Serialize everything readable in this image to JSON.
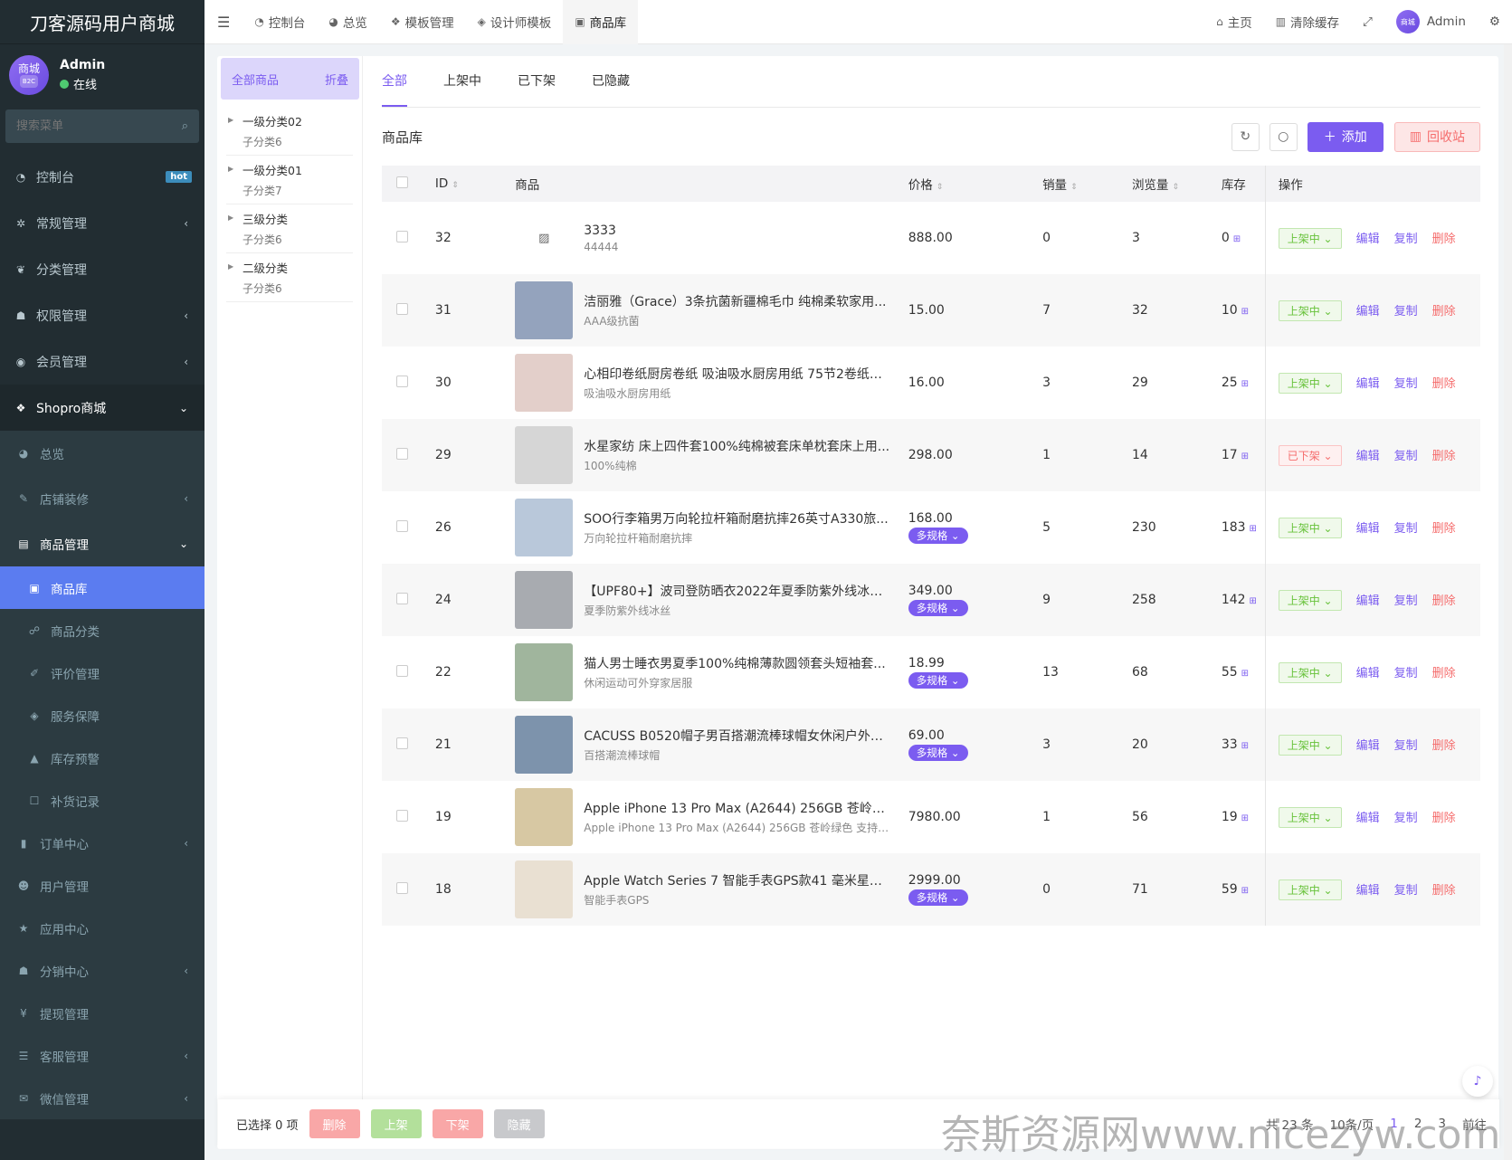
{
  "brand": "刀客源码用户商城",
  "user": {
    "name": "Admin",
    "status": "在线",
    "avatar_text": "商城",
    "avatar_badge": "B2C"
  },
  "search": {
    "placeholder": "搜索菜单"
  },
  "nav": [
    {
      "label": "控制台",
      "icon": "dashboard-icon",
      "badge": "hot"
    },
    {
      "label": "常规管理",
      "icon": "cogs-icon",
      "arrow": "‹"
    },
    {
      "label": "分类管理",
      "icon": "leaf-icon"
    },
    {
      "label": "权限管理",
      "icon": "group-icon",
      "arrow": "‹"
    },
    {
      "label": "会员管理",
      "icon": "user-circle-icon",
      "arrow": "‹"
    },
    {
      "label": "Shopro商城",
      "icon": "dropbox-icon",
      "arrow": "⌄"
    }
  ],
  "shopro": [
    {
      "label": "总览",
      "icon": "pie-icon"
    },
    {
      "label": "店铺装修",
      "icon": "brush-icon",
      "arrow": "‹"
    },
    {
      "label": "商品管理",
      "icon": "goods-icon",
      "arrow": "⌄"
    }
  ],
  "goods_menu": [
    {
      "label": "商品库",
      "icon": "bag-icon"
    },
    {
      "label": "商品分类",
      "icon": "sitemap-icon"
    },
    {
      "label": "评价管理",
      "icon": "edit-icon"
    },
    {
      "label": "服务保障",
      "icon": "tags-icon"
    },
    {
      "label": "库存预警",
      "icon": "warning-icon"
    },
    {
      "label": "补货记录",
      "icon": "square-icon"
    }
  ],
  "nav_bottom": [
    {
      "label": "订单中心",
      "icon": "file-icon",
      "arrow": "‹"
    },
    {
      "label": "用户管理",
      "icon": "user-icon"
    },
    {
      "label": "应用中心",
      "icon": "star-icon"
    },
    {
      "label": "分销中心",
      "icon": "users-icon",
      "arrow": "‹"
    },
    {
      "label": "提现管理",
      "icon": "yen-icon"
    },
    {
      "label": "客服管理",
      "icon": "list-icon",
      "arrow": "‹"
    },
    {
      "label": "微信管理",
      "icon": "wechat-icon",
      "arrow": "‹"
    }
  ],
  "topbar": {
    "tabs": [
      "控制台",
      "总览",
      "模板管理",
      "设计师模板",
      "商品库"
    ],
    "home": "主页",
    "clear": "清除缓存",
    "admin": "Admin",
    "avatar_text": "商城"
  },
  "categories": {
    "head": "全部商品",
    "fold": "折叠",
    "items": [
      {
        "name": "一级分类02",
        "child": "子分类6"
      },
      {
        "name": "一级分类01",
        "child": "子分类7"
      },
      {
        "name": "三级分类",
        "child": "子分类6"
      },
      {
        "name": "二级分类",
        "child": "子分类6"
      }
    ]
  },
  "tabs": [
    "全部",
    "上架中",
    "已下架",
    "已隐藏"
  ],
  "toolbar": {
    "title": "商品库",
    "add": "添加",
    "recycle": "回收站"
  },
  "columns": {
    "id": "ID",
    "goods": "商品",
    "price": "价格",
    "sales": "销量",
    "views": "浏览量",
    "stock": "库存",
    "ops": "操作"
  },
  "actions": {
    "edit": "编辑",
    "copy": "复制",
    "delete": "删除",
    "multi": "多规格"
  },
  "rows": [
    {
      "id": "32",
      "title": "3333",
      "sub": "44444",
      "price": "888.00",
      "multi": false,
      "sales": "0",
      "views": "3",
      "stock": "0",
      "status": "上架中",
      "on": true,
      "img": "none"
    },
    {
      "id": "31",
      "title": "洁丽雅（Grace）3条抗菌新疆棉毛巾 纯棉柔软家用...",
      "sub": "AAA级抗菌",
      "price": "15.00",
      "multi": false,
      "sales": "7",
      "views": "32",
      "stock": "10",
      "status": "上架中",
      "on": true,
      "img": "#94a3bd"
    },
    {
      "id": "30",
      "title": "心相印卷纸厨房卷纸 吸油吸水厨房用纸 75节2卷纸巾...",
      "sub": "吸油吸水厨房用纸",
      "price": "16.00",
      "multi": false,
      "sales": "3",
      "views": "29",
      "stock": "25",
      "status": "上架中",
      "on": true,
      "img": "#e3cfca"
    },
    {
      "id": "29",
      "title": "水星家纺 床上四件套100%纯棉被套床单枕套床上用...",
      "sub": "100%纯棉",
      "price": "298.00",
      "multi": false,
      "sales": "1",
      "views": "14",
      "stock": "17",
      "status": "已下架",
      "on": false,
      "img": "#d6d6d6"
    },
    {
      "id": "26",
      "title": "SOO行李箱男万向轮拉杆箱耐磨抗摔26英寸A330旅...",
      "sub": "万向轮拉杆箱耐磨抗摔",
      "price": "168.00",
      "multi": true,
      "sales": "5",
      "views": "230",
      "stock": "183",
      "status": "上架中",
      "on": true,
      "img": "#b9c8da"
    },
    {
      "id": "24",
      "title": "【UPF80+】波司登防晒衣2022年夏季防紫外线冰丝...",
      "sub": "夏季防紫外线冰丝",
      "price": "349.00",
      "multi": true,
      "sales": "9",
      "views": "258",
      "stock": "142",
      "status": "上架中",
      "on": true,
      "img": "#a8abb0"
    },
    {
      "id": "22",
      "title": "猫人男士睡衣男夏季100%纯棉薄款圆领套头短袖套...",
      "sub": "休闲运动可外穿家居服",
      "price": "18.99",
      "multi": true,
      "sales": "13",
      "views": "68",
      "stock": "55",
      "status": "上架中",
      "on": true,
      "img": "#a0b59d"
    },
    {
      "id": "21",
      "title": "CACUSS B0520帽子男百搭潮流棒球帽女休闲户外鸭...",
      "sub": "百搭潮流棒球帽",
      "price": "69.00",
      "multi": true,
      "sales": "3",
      "views": "20",
      "stock": "33",
      "status": "上架中",
      "on": true,
      "img": "#7d93ac"
    },
    {
      "id": "19",
      "title": "Apple iPhone 13 Pro Max (A2644) 256GB 苍岭绿...",
      "sub": "Apple iPhone 13 Pro Max (A2644) 256GB 苍岭绿色 支持移...",
      "price": "7980.00",
      "multi": false,
      "sales": "1",
      "views": "56",
      "stock": "19",
      "status": "上架中",
      "on": true,
      "img": "#d7c8a3"
    },
    {
      "id": "18",
      "title": "Apple Watch Series 7 智能手表GPS款41 毫米星光...",
      "sub": "智能手表GPS",
      "price": "2999.00",
      "multi": true,
      "sales": "0",
      "views": "71",
      "stock": "59",
      "status": "上架中",
      "on": true,
      "img": "#e9e0d2"
    }
  ],
  "footer": {
    "selected": "已选择 0 项",
    "delete": "删除",
    "on": "上架",
    "off": "下架",
    "hide": "隐藏",
    "total": "共 23 条",
    "per": "10条/页",
    "p1": "1",
    "p2": "2",
    "p3": "3",
    "goto": "前往"
  },
  "watermark": "奈斯资源网www.nicezyw.com"
}
